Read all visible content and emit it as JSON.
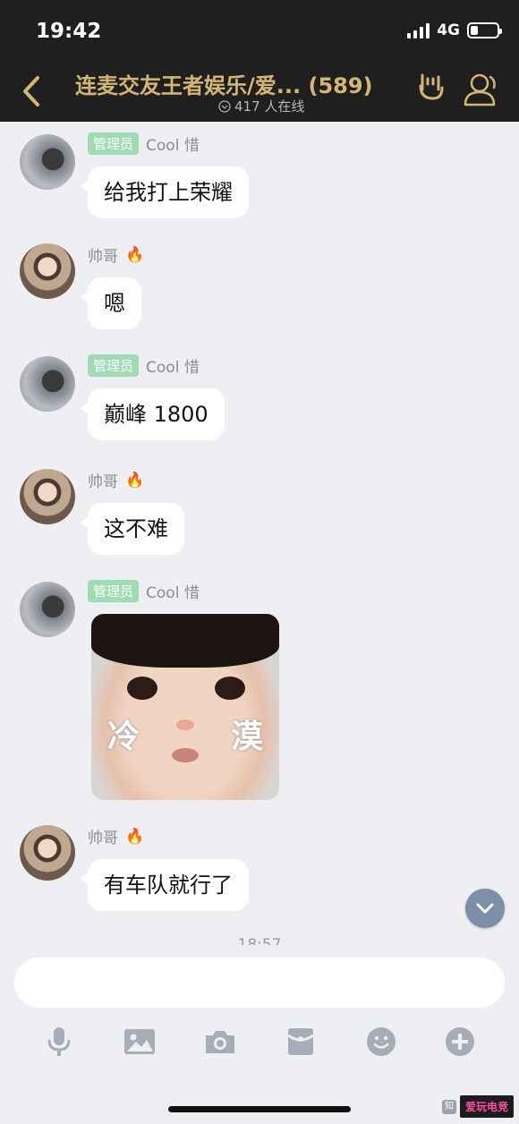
{
  "status_bar": {
    "time": "19:42",
    "network": "4G"
  },
  "header": {
    "title": "连麦交友王者娱乐/爱... (589)",
    "online": "417 人在线"
  },
  "messages": [
    {
      "sender": "Cool 惜",
      "badge": "管理员",
      "text": "给我打上荣耀"
    },
    {
      "sender": "帅哥",
      "badge": "",
      "text": "嗯"
    },
    {
      "sender": "Cool 惜",
      "badge": "管理员",
      "text": "巅峰 1800"
    },
    {
      "sender": "帅哥",
      "badge": "",
      "text": "这不难"
    },
    {
      "sender": "Cool 惜",
      "badge": "管理员",
      "sticker_left": "冷",
      "sticker_right": "漠"
    },
    {
      "sender": "帅哥",
      "badge": "",
      "text": "有车队就行了"
    }
  ],
  "time_divider": "18:57",
  "colors": {
    "header_bg": "#1f1f1f",
    "title_gold": "#d4b673",
    "badge_green": "#9fdcb4",
    "chat_bg": "#eeeff3"
  },
  "icons": {
    "back": "chevron-left-icon",
    "gesture": "rock-hand-icon",
    "members": "group-members-icon",
    "toolbar": [
      "microphone-icon",
      "image-icon",
      "camera-icon",
      "red-packet-icon",
      "emoji-icon",
      "plus-icon"
    ]
  },
  "watermark": {
    "logo": "爱玩电竞"
  }
}
